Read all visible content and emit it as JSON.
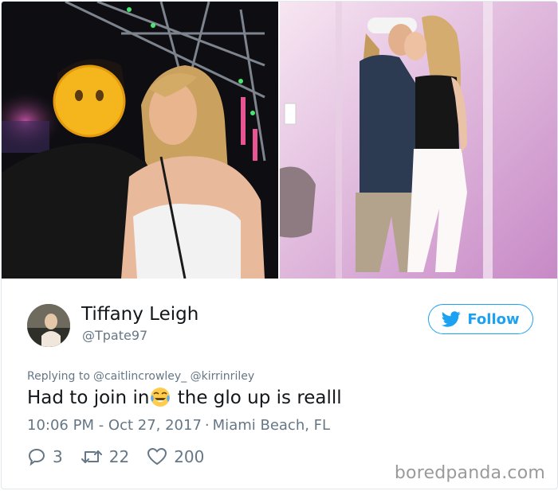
{
  "tweet": {
    "author": {
      "name": "Tiffany Leigh",
      "handle": "@Tpate97"
    },
    "follow_label": "Follow",
    "replying_label": "Replying to",
    "replying_to": [
      "@caitlincrowley_",
      "@kirrinriley"
    ],
    "text_before": "Had to join in",
    "emoji": "face-with-tears-of-joy",
    "text_after": " the glo up is realll",
    "time": "10:06 PM - Oct 27, 2017",
    "separator": "·",
    "location": "Miami Beach, FL",
    "reply_count": "3",
    "retweet_count": "22",
    "like_count": "200"
  },
  "watermark": "boredpanda.com",
  "colors": {
    "accent": "#1da1f2",
    "secondary_text": "#657786",
    "primary_text": "#14171a"
  },
  "icons": [
    "twitter-bird-icon",
    "reply-icon",
    "retweet-icon",
    "heart-icon",
    "emoji-icon"
  ]
}
